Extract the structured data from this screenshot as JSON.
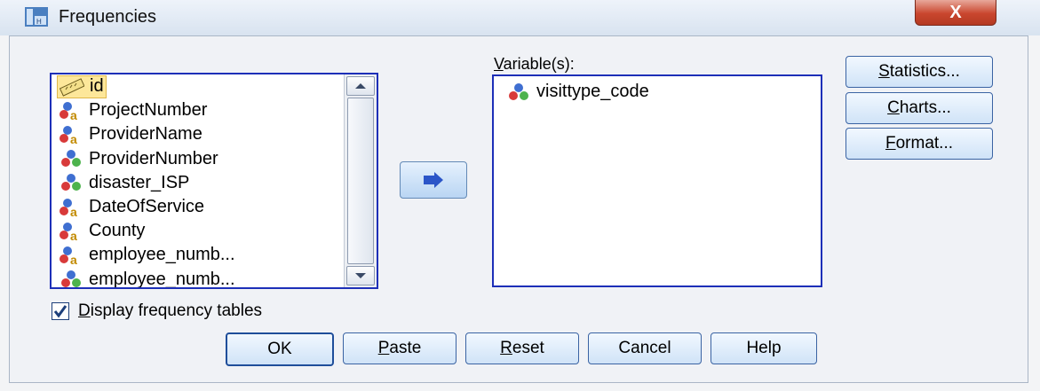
{
  "window": {
    "title": "Frequencies",
    "close_label": "X"
  },
  "source_list": {
    "items": [
      {
        "label": "id",
        "icon": "ruler-scale-icon",
        "selected": true
      },
      {
        "label": "ProjectNumber",
        "icon": "nominal-string-icon"
      },
      {
        "label": "ProviderName",
        "icon": "nominal-string-icon"
      },
      {
        "label": "ProviderNumber",
        "icon": "nominal-numeric-icon"
      },
      {
        "label": "disaster_ISP",
        "icon": "nominal-numeric-icon"
      },
      {
        "label": "DateOfService",
        "icon": "nominal-string-icon"
      },
      {
        "label": "County",
        "icon": "nominal-string-icon"
      },
      {
        "label": "employee_numb...",
        "icon": "nominal-string-icon"
      },
      {
        "label": "employee_numb...",
        "icon": "nominal-numeric-icon"
      }
    ]
  },
  "target": {
    "label_prefix": "V",
    "label_rest": "ariable(s):",
    "items": [
      {
        "label": "visittype_code",
        "icon": "nominal-numeric-icon"
      }
    ]
  },
  "side_buttons": [
    {
      "pre": "",
      "key": "S",
      "rest": "tatistics..."
    },
    {
      "pre": "",
      "key": "C",
      "rest": "harts..."
    },
    {
      "pre": "",
      "key": "F",
      "rest": "ormat..."
    }
  ],
  "checkbox": {
    "key": "D",
    "rest": "isplay frequency tables",
    "checked": true
  },
  "bottom_buttons": {
    "ok": "OK",
    "paste": {
      "key": "P",
      "rest": "aste"
    },
    "reset": {
      "key": "R",
      "rest": "eset"
    },
    "cancel": "Cancel",
    "help": "Help"
  },
  "colors": {
    "list_border": "#1d2fb8",
    "selection": "#fde79a",
    "accent_arrow": "#2b55c8"
  }
}
